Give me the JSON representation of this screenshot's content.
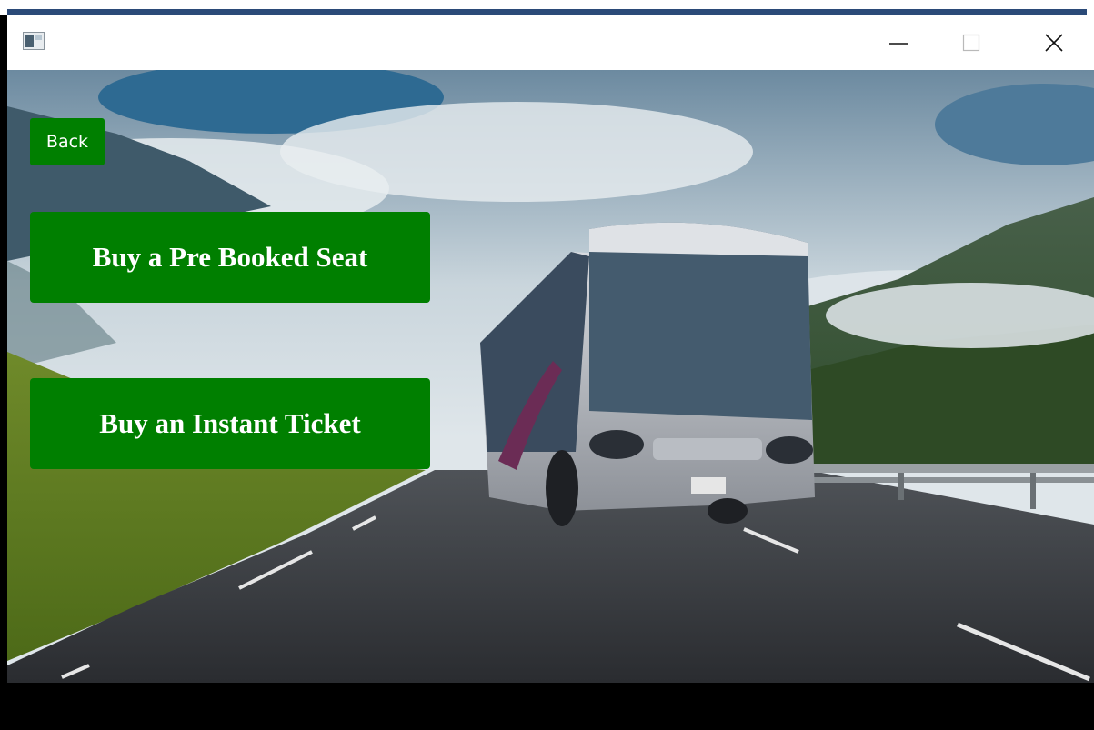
{
  "window": {
    "icon": "app-window-icon",
    "controls": {
      "minimize": "minimize-icon",
      "maximize": "maximize-icon",
      "close": "close-icon"
    }
  },
  "back_label": "Back",
  "actions": {
    "prebooked_label": "Buy a Pre Booked Seat",
    "instant_label": "Buy an Instant Ticket"
  },
  "colors": {
    "button_green": "#007f00",
    "title_accent": "#2b4a78"
  }
}
